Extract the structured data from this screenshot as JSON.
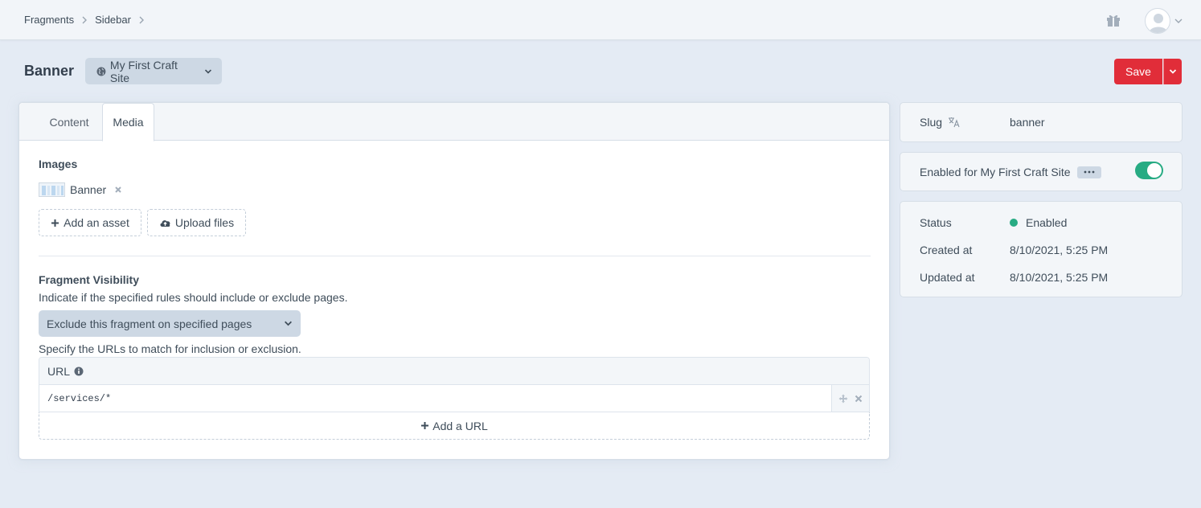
{
  "breadcrumb": [
    "Fragments",
    "Sidebar"
  ],
  "header": {
    "title": "Banner",
    "site": "My First Craft Site",
    "save_label": "Save"
  },
  "tabs": [
    {
      "label": "Content",
      "active": false
    },
    {
      "label": "Media",
      "active": true
    }
  ],
  "images": {
    "label": "Images",
    "assets": [
      {
        "title": "Banner"
      }
    ],
    "add_asset": "Add an asset",
    "upload_files": "Upload files"
  },
  "visibility": {
    "label": "Fragment Visibility",
    "instructions": "Indicate if the specified rules should include or exclude pages.",
    "select_value": "Exclude this fragment on specified pages",
    "url_instructions": "Specify the URLs to match for inclusion or exclusion.",
    "table_header": "URL",
    "rows": [
      "/services/*"
    ],
    "add_url": "Add a URL"
  },
  "sidebar": {
    "slug_label": "Slug",
    "slug_value": "banner",
    "enabled_label": "Enabled for My First Craft Site",
    "enabled": true,
    "meta": [
      {
        "label": "Status",
        "value": "Enabled"
      },
      {
        "label": "Created at",
        "value": "8/10/2021, 5:25 PM"
      },
      {
        "label": "Updated at",
        "value": "8/10/2021, 5:25 PM"
      }
    ]
  },
  "colors": {
    "accent_red": "#e12d39",
    "success_green": "#27ab83",
    "background": "#e4ebf4"
  },
  "icons": [
    "chevron-right-icon",
    "gift-icon",
    "user-avatar-icon",
    "globe-icon",
    "chevron-down-icon",
    "remove-icon",
    "plus-icon",
    "cloud-upload-icon",
    "info-icon",
    "move-icon",
    "translate-icon",
    "more-dots-icon"
  ]
}
